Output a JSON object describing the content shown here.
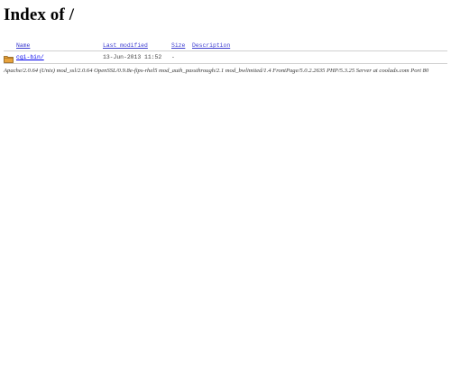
{
  "page": {
    "title": "Index of /"
  },
  "table": {
    "columns": {
      "name": "Name",
      "last_modified": "Last modified",
      "size": "Size",
      "description": "Description"
    },
    "rows": [
      {
        "icon": "folder-icon",
        "name": "cgi-bin/",
        "last_modified": "13-Jun-2013 11:52",
        "size": "-",
        "description": ""
      }
    ]
  },
  "footer": {
    "address": "Apache/2.0.64 (Unix) mod_ssl/2.0.64 OpenSSL/0.9.8e-fips-rhel5 mod_auth_passthrough/2.1 mod_bwlimited/1.4 FrontPage/5.0.2.2635 PHP/5.3.25 Server at coolads.com Port 80"
  },
  "colors": {
    "link": "#0000ee",
    "folder_fill": "#e8a33c",
    "folder_stroke": "#8a5a10"
  }
}
